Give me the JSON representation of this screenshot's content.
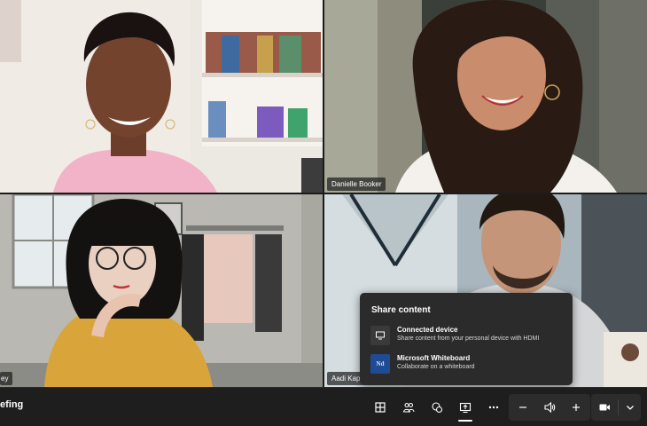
{
  "meeting": {
    "title": "efing"
  },
  "participants": [
    {
      "name": ""
    },
    {
      "name": "Danielle Booker"
    },
    {
      "name": "ey"
    },
    {
      "name": "Aadi Kap"
    }
  ],
  "share_panel": {
    "title": "Share content",
    "options": [
      {
        "title": "Connected device",
        "subtitle": "Share content from your personal device with HDMI",
        "icon": "monitor-icon"
      },
      {
        "title": "Microsoft Whiteboard",
        "subtitle": "Collaborate on a whiteboard",
        "icon": "whiteboard-icon",
        "icon_text": "Nd"
      }
    ]
  },
  "toolbar": {
    "items": [
      "layout-icon",
      "people-icon",
      "reactions-icon",
      "share-icon",
      "more-icon",
      "volume-down-icon",
      "speaker-icon",
      "volume-up-icon",
      "camera-icon",
      "chevron-down-icon"
    ],
    "active": "share-icon"
  },
  "colors": {
    "panel": "#2b2b2b",
    "bar": "#1e1e1e",
    "whiteboard_accent": "#1f4b94"
  }
}
